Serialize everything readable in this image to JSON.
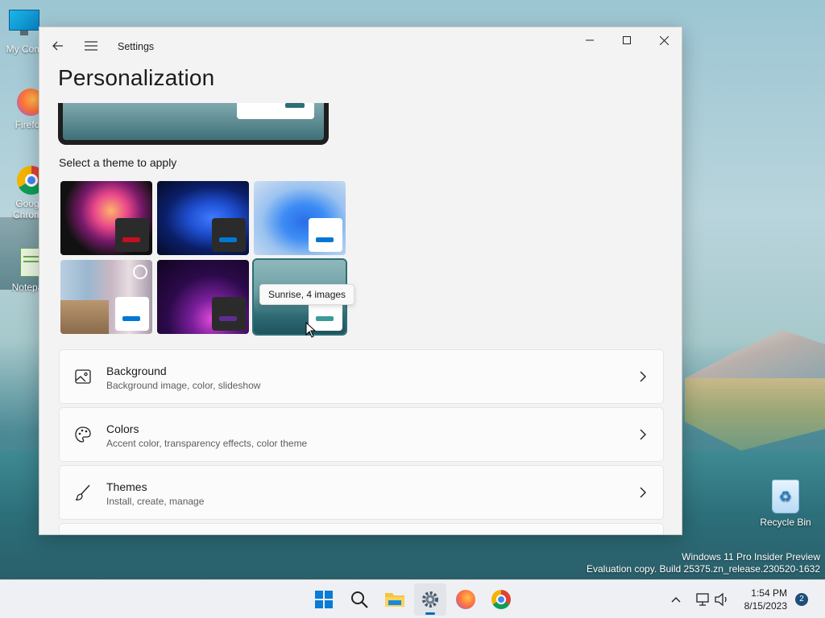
{
  "desktop": {
    "icons": [
      {
        "label": "My Com",
        "name": "my-computer"
      },
      {
        "label": "Firefo",
        "name": "firefox"
      },
      {
        "label": "Goog Chrom",
        "name": "chrome"
      },
      {
        "label": "Notepa",
        "name": "notepad"
      }
    ],
    "recycle_bin": "Recycle Bin",
    "watermark_line1": "Windows 11 Pro Insider Preview",
    "watermark_line2": "Evaluation copy. Build 25375.zn_release.230520-1632"
  },
  "window": {
    "app_title": "Settings",
    "page_title": "Personalization",
    "back_icon": "back-arrow-icon",
    "menu_icon": "hamburger-menu-icon"
  },
  "themes": {
    "label": "Select a theme to apply",
    "tooltip": "Sunrise, 4 images",
    "items": [
      {
        "name": "glow",
        "accent": "#c50f1f"
      },
      {
        "name": "windows-dark",
        "accent": "#0078d4"
      },
      {
        "name": "windows-light",
        "accent": "#0078d4"
      },
      {
        "name": "captured-motion",
        "accent": "#0078d4"
      },
      {
        "name": "flow",
        "accent": "#5c2e91"
      },
      {
        "name": "sunrise",
        "accent": "#3c9a9a",
        "selected": true
      }
    ]
  },
  "settings": [
    {
      "title": "Background",
      "subtitle": "Background image, color, slideshow",
      "icon": "image-icon"
    },
    {
      "title": "Colors",
      "subtitle": "Accent color, transparency effects, color theme",
      "icon": "palette-icon"
    },
    {
      "title": "Themes",
      "subtitle": "Install, create, manage",
      "icon": "brush-icon"
    }
  ],
  "taskbar": {
    "time": "1:54 PM",
    "date": "8/15/2023",
    "notification_count": "2"
  }
}
